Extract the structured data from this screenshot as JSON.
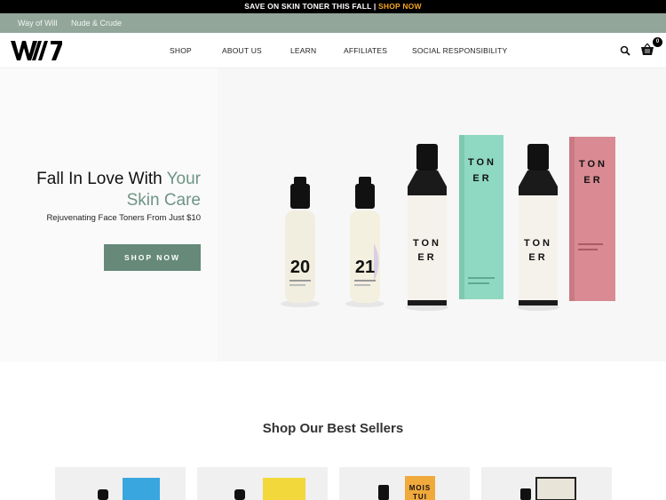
{
  "promo": {
    "text": "SAVE ON SKIN TONER THIS FALL | ",
    "link": "SHOP NOW"
  },
  "brand_bar": {
    "brand1": "Way of Will",
    "brand2": "Nude & Crude"
  },
  "nav": {
    "logo_icon": "wow-logo",
    "items": [
      "SHOP",
      "ABOUT US",
      "LEARN",
      "AFFILIATES",
      "SOCIAL RESPONSIBILITY"
    ],
    "search_icon": "search-icon",
    "cart_icon": "cart-icon",
    "cart_count": "0"
  },
  "hero": {
    "title_line1": "Fall In Love With ",
    "title_accent1": "Your",
    "title_accent2": "Skin Care",
    "subtitle": "Rejuvenating Face Toners From Just $10",
    "button": "SHOP NOW",
    "products": {
      "serum1_number": "20",
      "serum2_number": "21",
      "toner_box_word1": "TON",
      "toner_box_word2": "ER",
      "toner_bottle_word1": "TON",
      "toner_bottle_word2": "ER"
    }
  },
  "best_sellers": {
    "title": "Shop Our Best Sellers",
    "card3_label1": "MOIS",
    "card3_label2": "TUI"
  },
  "colors": {
    "accent": "#66897a",
    "brand_bar": "#92a69a",
    "promo_link": "#f5a623",
    "mint_box": "#8fd8c2",
    "pink_box": "#d98a93"
  }
}
